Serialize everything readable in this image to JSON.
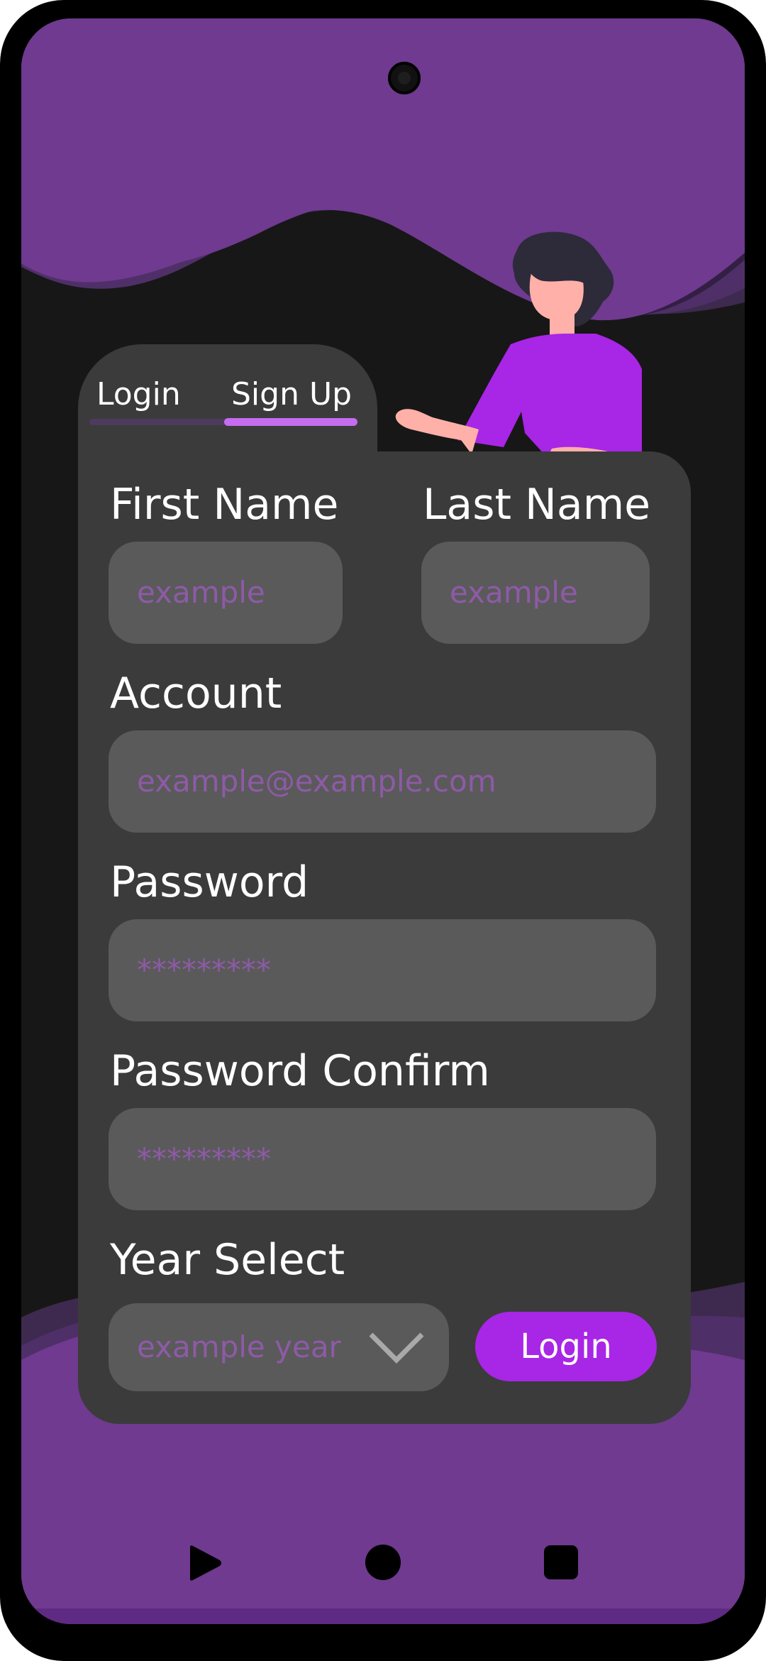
{
  "tabs": [
    {
      "label": "Login",
      "active": false
    },
    {
      "label": "Sign Up",
      "active": true
    }
  ],
  "form": {
    "first_name": {
      "label": "First Name",
      "placeholder": "example"
    },
    "last_name": {
      "label": "Last Name",
      "placeholder": "example"
    },
    "account": {
      "label": "Account",
      "placeholder": "example@example.com"
    },
    "password": {
      "label": "Password",
      "placeholder": "*********"
    },
    "password_confirm": {
      "label": "Password Confirm",
      "placeholder": "*********"
    },
    "year_select": {
      "label": "Year Select",
      "placeholder": "example year"
    },
    "submit_label": "Login"
  },
  "nav_bar": {
    "back_icon": "play-triangle-icon",
    "home_icon": "circle-icon",
    "recents_icon": "square-icon"
  },
  "colors": {
    "accent": "#a826e6",
    "header_purple": "#6f3a8f",
    "card": "#3b3b3b",
    "field": "#5a5a5a",
    "placeholder": "#8e5aa8",
    "background": "#171717"
  }
}
